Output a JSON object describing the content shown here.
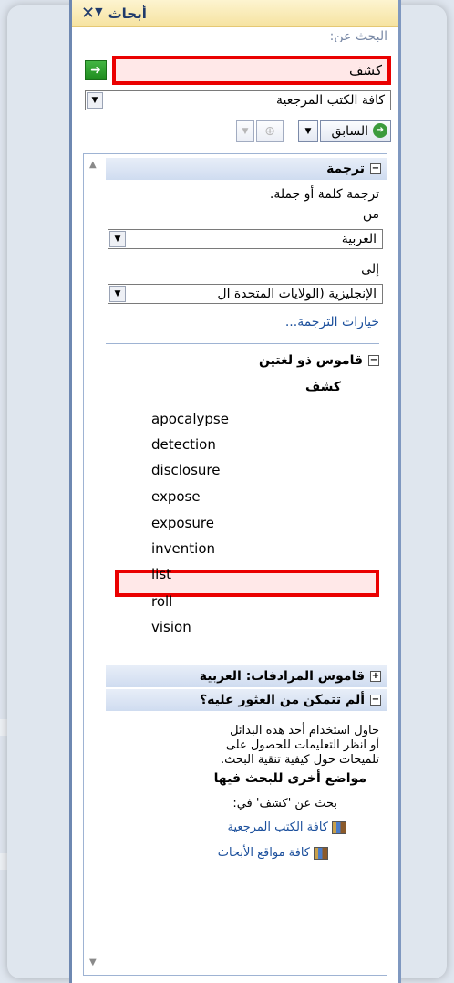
{
  "pane": {
    "title": "أبحاث",
    "search_label": "البحث عن:",
    "search_value": "كشف",
    "reference_select": "كافة الكتب المرجعية",
    "back_label": "السابق"
  },
  "translation": {
    "header": "ترجمة",
    "desc": "ترجمة كلمة أو جملة.",
    "from_label": "من",
    "from_value": "العربية",
    "to_label": "إلى",
    "to_value": "الإنجليزية (الولايات المتحدة ال",
    "options_link": "خيارات الترجمة..."
  },
  "dictionary": {
    "header": "قاموس ذو لغتين",
    "term": "كشف",
    "words": [
      "apocalypse",
      "detection",
      "disclosure",
      "expose",
      "exposure",
      "invention",
      "list",
      "roll",
      "vision"
    ]
  },
  "thesaurus": {
    "header": "قاموس المرادفات: العربية"
  },
  "not_found": {
    "header": "ألم تتمكن من العثور عليه؟",
    "lines": [
      "حاول استخدام أحد هذه البدائل",
      "أو انظر التعليمات للحصول على",
      "تلميحات حول كيفية تنقية البحث."
    ],
    "other_places": "مواضع أخرى للبحث فيها",
    "search_for": "بحث عن 'كشف' في:",
    "link_books": "كافة الكتب المرجعية",
    "link_sites": "كافة مواقع الأبحاث"
  }
}
